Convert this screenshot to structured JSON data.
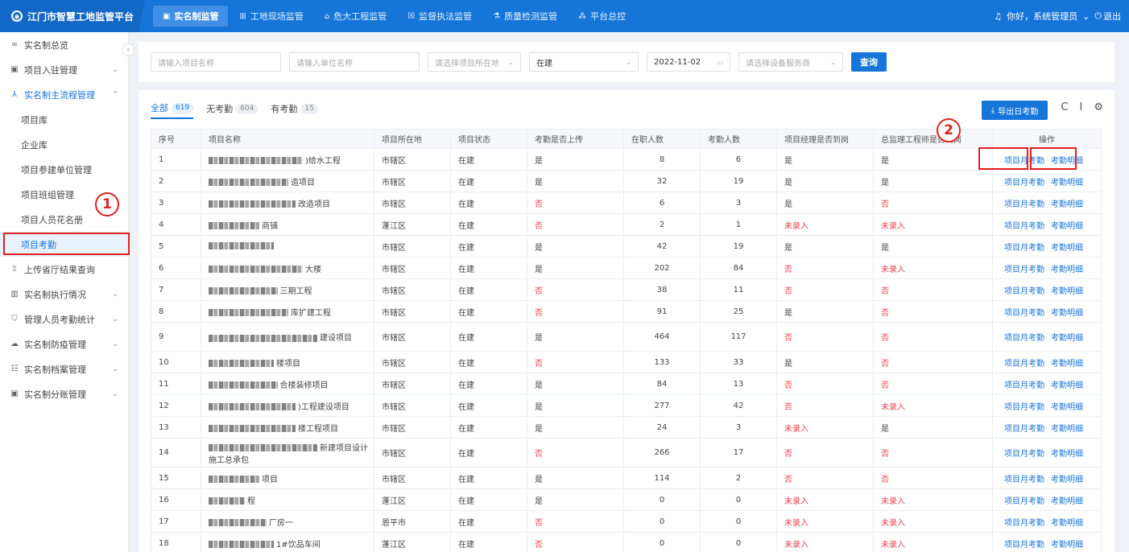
{
  "brand": {
    "title": "江门市智慧工地监管平台"
  },
  "topnav": [
    {
      "label": "实名制监管",
      "icon": "id-card-icon",
      "glyph": "▣"
    },
    {
      "label": "工地现场监管",
      "icon": "grid-icon",
      "glyph": "⊞"
    },
    {
      "label": "危大工程监管",
      "icon": "building-icon",
      "glyph": "⌂"
    },
    {
      "label": "监督执法监管",
      "icon": "document-icon",
      "glyph": "☒"
    },
    {
      "label": "质量检测监管",
      "icon": "flask-icon",
      "glyph": "⚗"
    },
    {
      "label": "平台总控",
      "icon": "network-icon",
      "glyph": "⁂"
    }
  ],
  "user": {
    "greeting": "你好，系统管理员",
    "logout": "退出"
  },
  "sidebar": {
    "items": [
      {
        "label": "实名制总览",
        "icon": "link-icon",
        "glyph": "∞",
        "chevron": ""
      },
      {
        "label": "项目入驻管理",
        "icon": "square-icon",
        "glyph": "▣",
        "chevron": "⌄"
      },
      {
        "label": "实名制主流程管理",
        "icon": "people-icon",
        "glyph": "⅄",
        "chevron": "⌃"
      },
      {
        "label": "项目库",
        "sub": true
      },
      {
        "label": "企业库",
        "sub": true
      },
      {
        "label": "项目参建单位管理",
        "sub": true
      },
      {
        "label": "项目班组管理",
        "sub": true
      },
      {
        "label": "项目人员花名册",
        "sub": true
      },
      {
        "label": "项目考勤",
        "sub": true
      },
      {
        "label": "上传省厅结果查询",
        "icon": "upload-icon",
        "glyph": "⇧",
        "chevron": ""
      },
      {
        "label": "实名制执行情况",
        "icon": "chart-icon",
        "glyph": "▥",
        "chevron": "⌄"
      },
      {
        "label": "管理人员考勤统计",
        "icon": "shield-icon",
        "glyph": "⛉",
        "chevron": "⌄"
      },
      {
        "label": "实名制防疫管理",
        "icon": "cloud-icon",
        "glyph": "☁",
        "chevron": "⌄"
      },
      {
        "label": "实名制档案管理",
        "icon": "archive-icon",
        "glyph": "☷",
        "chevron": "⌄"
      },
      {
        "label": "实名制分账管理",
        "icon": "wallet-icon",
        "glyph": "▣",
        "chevron": "⌄"
      }
    ]
  },
  "filters": {
    "project_name_placeholder": "请输入项目名称",
    "unit_name_placeholder": "请输入单位名称",
    "location_placeholder": "请选择项目所在地",
    "status_value": "在建",
    "date_value": "2022-11-02",
    "vendor_placeholder": "请选择设备服务商",
    "query_label": "查询"
  },
  "tabs": [
    {
      "label": "全部",
      "count": "619"
    },
    {
      "label": "无考勤",
      "count": "604"
    },
    {
      "label": "有考勤",
      "count": "15"
    }
  ],
  "toolbar": {
    "export_label": "导出日考勤"
  },
  "table": {
    "headers": [
      "序号",
      "项目名称",
      "项目所在地",
      "项目状态",
      "考勤是否上传",
      "在职人数",
      "考勤人数",
      "项目经理是否到岗",
      "总监理工程师是否到岗",
      "操作"
    ],
    "ops": {
      "monthly": "项目月考勤",
      "detail": "考勤明细"
    },
    "rows": [
      {
        "no": "1",
        "name": ")给水工程",
        "loc": "市辖区",
        "status": "在建",
        "upload": "是",
        "staff": "8",
        "att": "6",
        "pm": "是",
        "sup": "是"
      },
      {
        "no": "2",
        "name": "造项目",
        "loc": "市辖区",
        "status": "在建",
        "upload": "是",
        "staff": "32",
        "att": "19",
        "pm": "是",
        "sup": "是"
      },
      {
        "no": "3",
        "name": "改造项目",
        "loc": "市辖区",
        "status": "在建",
        "upload": "否",
        "staff": "6",
        "att": "3",
        "pm": "是",
        "sup": "否"
      },
      {
        "no": "4",
        "name": "商铺",
        "loc": "蓬江区",
        "status": "在建",
        "upload": "否",
        "staff": "2",
        "att": "1",
        "pm": "未录入",
        "sup": "未录入"
      },
      {
        "no": "5",
        "name": "",
        "loc": "市辖区",
        "status": "在建",
        "upload": "是",
        "staff": "42",
        "att": "19",
        "pm": "是",
        "sup": "是"
      },
      {
        "no": "6",
        "name": "大楼",
        "loc": "市辖区",
        "status": "在建",
        "upload": "是",
        "staff": "202",
        "att": "84",
        "pm": "否",
        "sup": "未录入"
      },
      {
        "no": "7",
        "name": "三期工程",
        "loc": "市辖区",
        "status": "在建",
        "upload": "否",
        "staff": "38",
        "att": "11",
        "pm": "否",
        "sup": "否"
      },
      {
        "no": "8",
        "name": "库扩建工程",
        "loc": "市辖区",
        "status": "在建",
        "upload": "否",
        "staff": "91",
        "att": "25",
        "pm": "是",
        "sup": "否"
      },
      {
        "no": "9",
        "name": "建设项目",
        "loc": "市辖区",
        "status": "在建",
        "upload": "是",
        "staff": "464",
        "att": "117",
        "pm": "否",
        "sup": "否",
        "tall": true
      },
      {
        "no": "10",
        "name": "楼项目",
        "loc": "市辖区",
        "status": "在建",
        "upload": "否",
        "staff": "133",
        "att": "33",
        "pm": "是",
        "sup": "否"
      },
      {
        "no": "11",
        "name": "合楼装修项目",
        "loc": "市辖区",
        "status": "在建",
        "upload": "是",
        "staff": "84",
        "att": "13",
        "pm": "否",
        "sup": "否"
      },
      {
        "no": "12",
        "name": ")工程建设项目",
        "loc": "市辖区",
        "status": "在建",
        "upload": "是",
        "staff": "277",
        "att": "42",
        "pm": "否",
        "sup": "未录入"
      },
      {
        "no": "13",
        "name": "楼工程项目",
        "loc": "市辖区",
        "status": "在建",
        "upload": "是",
        "staff": "24",
        "att": "3",
        "pm": "未录入",
        "sup": "是"
      },
      {
        "no": "14",
        "name": "新建项目设计施工总承包",
        "loc": "市辖区",
        "status": "在建",
        "upload": "否",
        "staff": "266",
        "att": "17",
        "pm": "否",
        "sup": "否",
        "tall": true
      },
      {
        "no": "15",
        "name": "项目",
        "loc": "市辖区",
        "status": "在建",
        "upload": "是",
        "staff": "114",
        "att": "2",
        "pm": "否",
        "sup": "否"
      },
      {
        "no": "16",
        "name": "程",
        "loc": "蓬江区",
        "status": "在建",
        "upload": "是",
        "staff": "0",
        "att": "0",
        "pm": "未录入",
        "sup": "未录入"
      },
      {
        "no": "17",
        "name": "厂房一",
        "loc": "恩平市",
        "status": "在建",
        "upload": "否",
        "staff": "0",
        "att": "0",
        "pm": "未录入",
        "sup": "未录入"
      },
      {
        "no": "18",
        "name": "1#饮品车间",
        "loc": "蓬江区",
        "status": "在建",
        "upload": "否",
        "staff": "0",
        "att": "0",
        "pm": "未录入",
        "sup": "未录入"
      }
    ]
  },
  "annotations": {
    "marker1": "1",
    "marker2": "2"
  }
}
